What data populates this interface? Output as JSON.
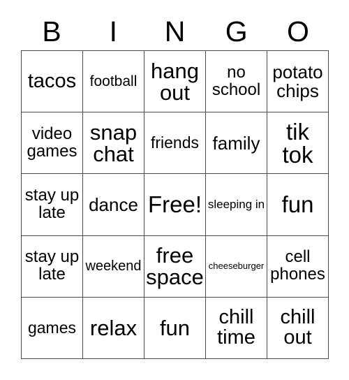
{
  "card": {
    "title_letters": [
      "B",
      "I",
      "N",
      "G",
      "O"
    ],
    "colors": {
      "background": "#ffffff",
      "text": "#000000",
      "border": "#4a4a4a"
    },
    "grid": {
      "rows": 5,
      "columns": 5,
      "cells": [
        [
          {
            "text": "tacos",
            "size": "fs-2xl"
          },
          {
            "text": "football",
            "size": "fs-m"
          },
          {
            "text": "hang out",
            "size": "fs-3xl"
          },
          {
            "text": "no school",
            "size": "fs-l"
          },
          {
            "text": "potato chips",
            "size": "fs-xl"
          }
        ],
        [
          {
            "text": "video games",
            "size": "fs-l"
          },
          {
            "text": "snap chat",
            "size": "fs-3xl"
          },
          {
            "text": "friends",
            "size": "fs-ml"
          },
          {
            "text": "family",
            "size": "fs-xl"
          },
          {
            "text": "tik tok",
            "size": "fs-4xl"
          }
        ],
        [
          {
            "text": "stay up late",
            "size": "fs-l"
          },
          {
            "text": "dance",
            "size": "fs-xl"
          },
          {
            "text": "Free!",
            "size": "fs-4xl"
          },
          {
            "text": "sleeping in",
            "size": "fs-s"
          },
          {
            "text": "fun",
            "size": "fs-4xl"
          }
        ],
        [
          {
            "text": "stay up late",
            "size": "fs-l"
          },
          {
            "text": "weekend",
            "size": "fs-sm"
          },
          {
            "text": "free space",
            "size": "fs-3xl"
          },
          {
            "text": "cheeseburger",
            "size": "fs-xs"
          },
          {
            "text": "cell phones",
            "size": "fs-l"
          }
        ],
        [
          {
            "text": "games",
            "size": "fs-ml"
          },
          {
            "text": "relax",
            "size": "fs-3xl"
          },
          {
            "text": "fun",
            "size": "fs-3xl"
          },
          {
            "text": "chill time",
            "size": "fs-2xl"
          },
          {
            "text": "chill out",
            "size": "fs-2xl"
          }
        ]
      ]
    }
  }
}
